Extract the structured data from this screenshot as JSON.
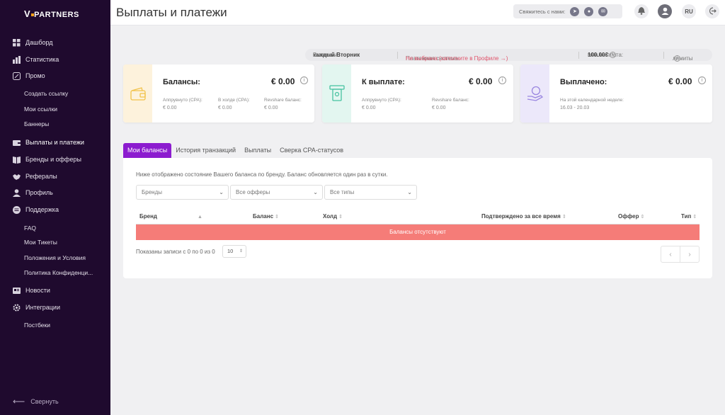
{
  "brand": {
    "logo": "V.PARTNERS"
  },
  "sidebar": {
    "items": [
      {
        "label": "Дашборд"
      },
      {
        "label": "Статистика"
      },
      {
        "label": "Промо"
      },
      {
        "label": "Создать ссылку"
      },
      {
        "label": "Мои ссылки"
      },
      {
        "label": "Баннеры"
      },
      {
        "label": "Выплаты и платежи"
      },
      {
        "label": "Бренды и офферы"
      },
      {
        "label": "Рефералы"
      },
      {
        "label": "Профиль"
      },
      {
        "label": "Поддержка"
      },
      {
        "label": "FAQ"
      },
      {
        "label": "Мои Тикеты"
      },
      {
        "label": "Положения и Условия"
      },
      {
        "label": "Политика Конфиденци..."
      },
      {
        "label": "Новости"
      },
      {
        "label": "Интеграции"
      },
      {
        "label": "Постбеки"
      }
    ],
    "collapse_label": "Свернуть"
  },
  "header": {
    "title": "Выплаты и платежи",
    "contact_label": "Свяжитесь с нами:",
    "lang": "RU"
  },
  "infobar": {
    "payouts_label": "Выплаты:",
    "payouts_value": "каждый Вторник",
    "system_label": "Платежная система:",
    "system_value": "Не выбрана (заполните в Профиле →)",
    "min_label": "мин.выплата:",
    "min_value": "100.00€",
    "limits_label": "лимиты"
  },
  "cards": {
    "balances": {
      "title": "Балансы:",
      "amount": "€ 0.00",
      "cols": [
        {
          "label": "Аппрувнуто (CPA):",
          "value": "€ 0.00"
        },
        {
          "label": "В холде (CPA):",
          "value": "€ 0.00"
        },
        {
          "label": "Revshare баланс:",
          "value": "€ 0.00"
        }
      ]
    },
    "topay": {
      "title": "К выплате:",
      "amount": "€ 0.00",
      "cols": [
        {
          "label": "Аппрувнуто (CPA):",
          "value": "€ 0.00"
        },
        {
          "label": "Revshare баланс:",
          "value": "€ 0.00"
        }
      ]
    },
    "paid": {
      "title": "Выплачено:",
      "amount": "€ 0.00",
      "cols": [
        {
          "label": "На этой календарной неделе:",
          "value": "16.03 - 20.03"
        }
      ]
    }
  },
  "tabs": [
    {
      "label": "Мои балансы",
      "active": true
    },
    {
      "label": "История транзакций",
      "active": false
    },
    {
      "label": "Выплаты",
      "active": false
    },
    {
      "label": "Сверка CPA-статусов",
      "active": false
    }
  ],
  "panel": {
    "description": "Ниже отображено состояние Вашего баланса по бренду. Баланс обновляется один раз в сутки.",
    "filters": {
      "brands": "Бренды",
      "offers": "Все офферы",
      "types": "Все типы"
    },
    "columns": [
      "Бренд",
      "Баланс",
      "Холд",
      "Подтверждено за все время",
      "Оффер",
      "Тип"
    ],
    "empty_text": "Балансы отсутствуют",
    "footer_info": "Показаны записи с 0 по 0 из 0",
    "page_size": "10"
  },
  "colors": {
    "sidebar": "#1f0a2e",
    "accent": "#8c1ccf",
    "empty_row": "#f57c78",
    "error_text": "#e1556c"
  }
}
